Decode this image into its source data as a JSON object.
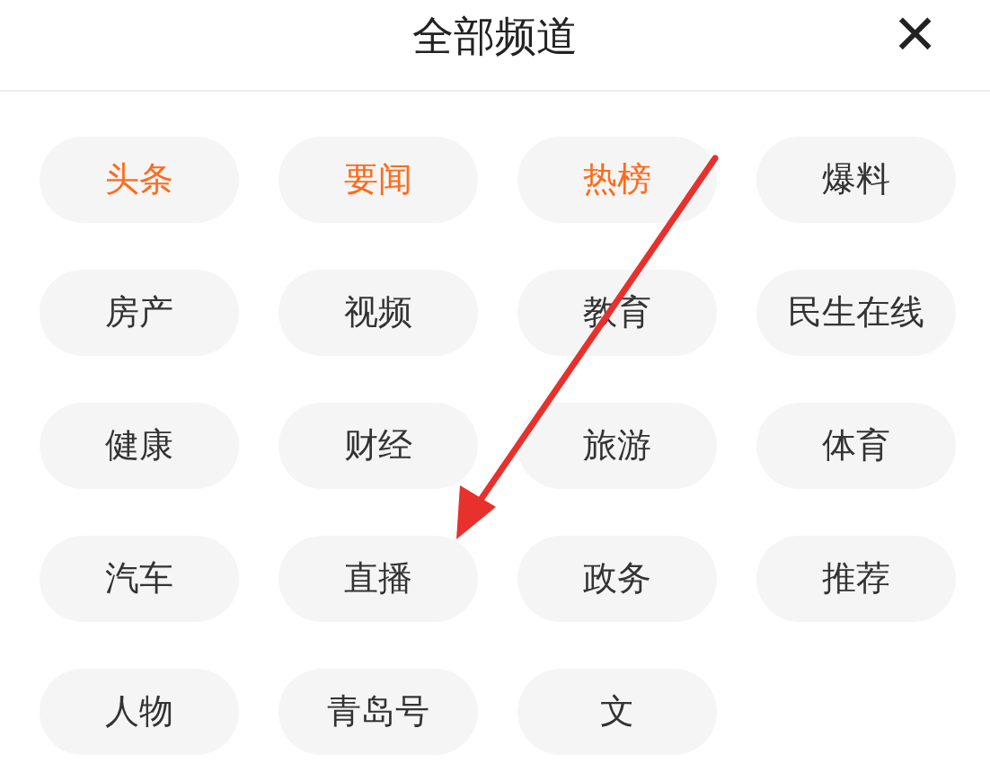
{
  "header": {
    "title": "全部频道",
    "close": "×"
  },
  "channels": [
    {
      "label": "头条",
      "highlighted": true
    },
    {
      "label": "要闻",
      "highlighted": true
    },
    {
      "label": "热榜",
      "highlighted": true
    },
    {
      "label": "爆料",
      "highlighted": false
    },
    {
      "label": "房产",
      "highlighted": false
    },
    {
      "label": "视频",
      "highlighted": false
    },
    {
      "label": "教育",
      "highlighted": false
    },
    {
      "label": "民生在线",
      "highlighted": false
    },
    {
      "label": "健康",
      "highlighted": false
    },
    {
      "label": "财经",
      "highlighted": false
    },
    {
      "label": "旅游",
      "highlighted": false
    },
    {
      "label": "体育",
      "highlighted": false
    },
    {
      "label": "汽车",
      "highlighted": false
    },
    {
      "label": "直播",
      "highlighted": false
    },
    {
      "label": "政务",
      "highlighted": false
    },
    {
      "label": "推荐",
      "highlighted": false
    },
    {
      "label": "人物",
      "highlighted": false
    },
    {
      "label": "青岛号",
      "highlighted": false
    },
    {
      "label": "文",
      "highlighted": false
    }
  ]
}
